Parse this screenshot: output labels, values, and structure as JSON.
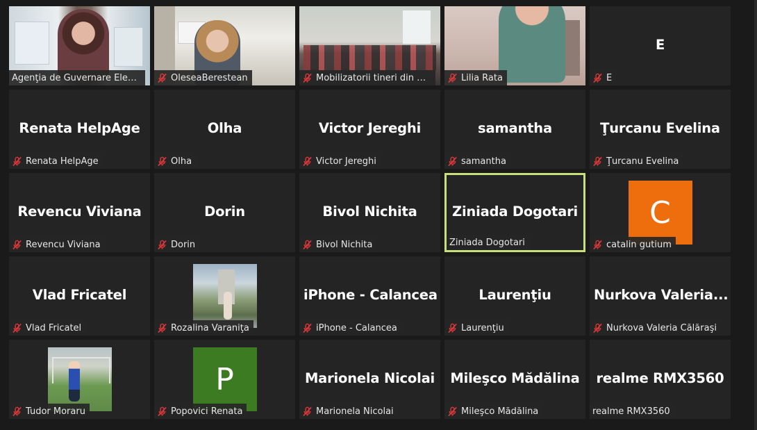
{
  "participants": [
    {
      "label": "Agenţia de Guvernare Electr...",
      "muted": false,
      "kind": "video",
      "video": "v1"
    },
    {
      "label": "OleseaBerestean",
      "muted": true,
      "kind": "video",
      "video": "v2"
    },
    {
      "label": "Mobilizatorii tineri din or...",
      "muted": true,
      "kind": "video",
      "video": "v3"
    },
    {
      "label": "Lilia Rata",
      "muted": true,
      "kind": "video",
      "video": "v4"
    },
    {
      "label": "E",
      "muted": true,
      "kind": "name",
      "display": "E"
    },
    {
      "label": "Renata HelpAge",
      "muted": true,
      "kind": "name",
      "display": "Renata HelpAge"
    },
    {
      "label": "Olha",
      "muted": true,
      "kind": "name",
      "display": "Olha"
    },
    {
      "label": "Victor Jereghi",
      "muted": true,
      "kind": "name",
      "display": "Victor Jereghi"
    },
    {
      "label": "samantha",
      "muted": true,
      "kind": "name",
      "display": "samantha"
    },
    {
      "label": "Ţurcanu Evelina",
      "muted": true,
      "kind": "name",
      "display": "Ţurcanu Evelina"
    },
    {
      "label": "Revencu Viviana",
      "muted": true,
      "kind": "name",
      "display": "Revencu Viviana"
    },
    {
      "label": "Dorin",
      "muted": true,
      "kind": "name",
      "display": "Dorin"
    },
    {
      "label": "Bivol Nichita",
      "muted": true,
      "kind": "name",
      "display": "Bivol Nichita"
    },
    {
      "label": "Ziniada Dogotari",
      "muted": false,
      "kind": "name",
      "display": "Ziniada Dogotari",
      "active": true
    },
    {
      "label": "catalin gutium",
      "muted": true,
      "kind": "avatar",
      "letter": "C",
      "color": "#ee6e0e"
    },
    {
      "label": "Vlad Fricatel",
      "muted": true,
      "kind": "name",
      "display": "Vlad Fricatel"
    },
    {
      "label": "Rozalina Varaniţa",
      "muted": true,
      "kind": "photo",
      "photo": "rozalina"
    },
    {
      "label": "iPhone - Calancea",
      "muted": true,
      "kind": "name",
      "display": "iPhone - Calancea"
    },
    {
      "label": "Laurenţiu",
      "muted": true,
      "kind": "name",
      "display": "Laurenţiu"
    },
    {
      "label": "Nurkova Valeria Călăraşi",
      "muted": true,
      "kind": "name",
      "display": "Nurkova  Valeria..."
    },
    {
      "label": "Tudor Moraru",
      "muted": true,
      "kind": "photo",
      "photo": "tudor"
    },
    {
      "label": "Popovici Renata",
      "muted": true,
      "kind": "avatar",
      "letter": "P",
      "color": "#3d7b22"
    },
    {
      "label": "Marionela Nicolai",
      "muted": true,
      "kind": "name",
      "display": "Marionela Nicolai"
    },
    {
      "label": "Mileşco Mădălina",
      "muted": true,
      "kind": "name",
      "display": "Mileşco Mădălina"
    },
    {
      "label": "realme RMX3560",
      "muted": false,
      "kind": "name",
      "display": "realme RMX3560"
    }
  ],
  "colors": {
    "background": "#1a1a1a",
    "tile": "#242424",
    "active_border": "#c8e07a",
    "muted_icon": "#e0383a"
  },
  "icons": {
    "muted": "mic-muted-icon"
  }
}
